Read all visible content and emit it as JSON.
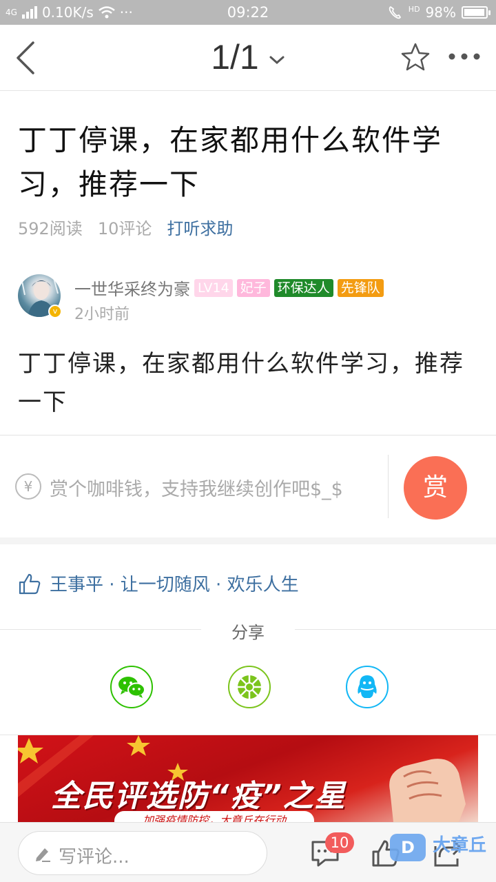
{
  "status_bar": {
    "network": "4G",
    "speed": "0.10K/s",
    "dots": "···",
    "time": "09:22",
    "hd": "HD",
    "battery": "98%",
    "battery_level": 0.98
  },
  "nav": {
    "page_indicator": "1/1",
    "icons": [
      "back-arrow-icon",
      "chevron-down-icon",
      "star-icon",
      "more-icon"
    ]
  },
  "article": {
    "title": "丁丁停课，在家都用什么软件学习，推荐一下",
    "reads": "592阅读",
    "comments": "10评论",
    "category": "打听求助",
    "author": {
      "name": "一世华采终为豪",
      "badges": [
        "LV14",
        "妃子",
        "环保达人",
        "先锋队"
      ],
      "time": "2小时前",
      "verified_mark": "v"
    },
    "body": "丁丁停课，在家都用什么软件学习，推荐一下"
  },
  "tip": {
    "yen": "¥",
    "placeholder": "赏个咖啡钱，支持我继续创作吧$_$",
    "button": "赏"
  },
  "likes": {
    "text": "王事平 · 让一切随风 · 欢乐人生"
  },
  "share": {
    "label": "分享",
    "targets": [
      {
        "icon": "wechat-icon",
        "color": "#2dc100"
      },
      {
        "icon": "moments-icon",
        "color": "#7bc41c"
      },
      {
        "icon": "qq-icon",
        "color": "#12b7f5"
      }
    ]
  },
  "banner": {
    "title": "全民评选防“疫”之星",
    "subtitle": "加强疫情防控，大章丘在行动"
  },
  "bottom_bar": {
    "comment_placeholder": "写评论...",
    "comment_count": "10",
    "watermark": "大章丘",
    "watermark_logo": "D"
  },
  "colors": {
    "accent_blue": "#3d6fa0",
    "tip_button": "#fa6f55",
    "badge_red": "#f25c5c"
  }
}
